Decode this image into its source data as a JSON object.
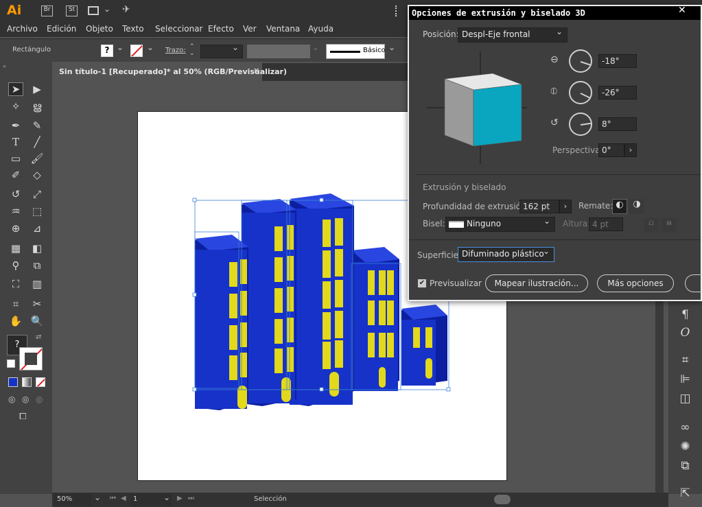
{
  "app": {
    "logo": "Ai",
    "bridge": "Br",
    "stock": "St"
  },
  "menu": [
    "Archivo",
    "Edición",
    "Objeto",
    "Texto",
    "Seleccionar",
    "Efecto",
    "Ver",
    "Ventana",
    "Ayuda"
  ],
  "control": {
    "object_type": "Rectángulo",
    "fill_q": "?",
    "stroke_label": "Trazo:",
    "brush": "Básico"
  },
  "doc": {
    "tab_title": "Sin título-1 [Recuperado]* al 50% (RGB/Previsualizar)",
    "close": "×"
  },
  "tools": {
    "help": "?"
  },
  "status": {
    "zoom": "50%",
    "page": "1",
    "tool": "Selección"
  },
  "dialog": {
    "title": "Opciones de extrusión y biselado 3D",
    "position_label": "Posición:",
    "position_value": "Despl-Eje frontal",
    "rot_x": "-18°",
    "rot_y": "-26°",
    "rot_z": "8°",
    "perspective_label": "Perspectiva:",
    "perspective_value": "0°",
    "section": "Extrusión y biselado",
    "depth_label": "Profundidad de extrusión:",
    "depth_value": "162 pt",
    "cap_label": "Remate:",
    "bevel_label": "Bisel:",
    "bevel_value": "Ninguno",
    "height_label": "Altura:",
    "height_value": "4 pt",
    "surface_label": "Superficie:",
    "surface_value": "Difuminado plástico",
    "preview_label": "Previsualizar",
    "map_button": "Mapear ilustración...",
    "more_button": "Más opciones"
  },
  "colors": {
    "building": "#1632c8",
    "window_yellow": "#e2d81c",
    "cube_face": "#0aa6bf"
  }
}
